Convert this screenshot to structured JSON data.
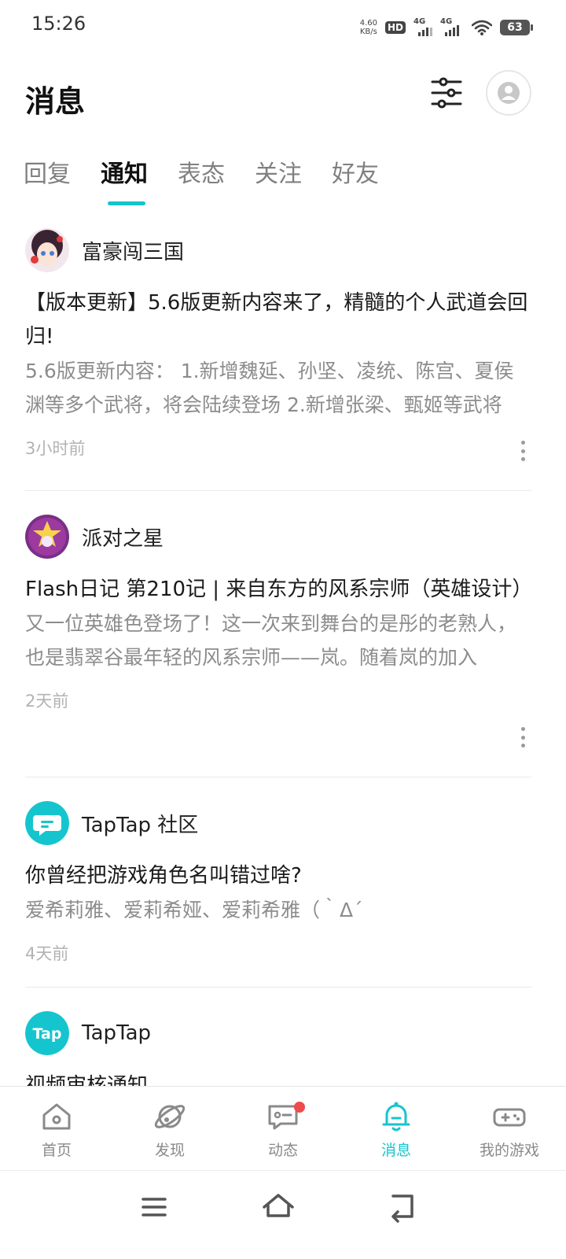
{
  "status_bar": {
    "time": "15:26",
    "net_speed_value": "4.60",
    "net_speed_unit": "KB/s",
    "hd_label": "HD",
    "sim1_label": "4G",
    "sim2_label": "4G",
    "battery": "63"
  },
  "header": {
    "title": "消息"
  },
  "tabs": [
    {
      "label": "回复",
      "active": false
    },
    {
      "label": "通知",
      "active": true
    },
    {
      "label": "表态",
      "active": false
    },
    {
      "label": "关注",
      "active": false
    },
    {
      "label": "好友",
      "active": false
    }
  ],
  "notifications": [
    {
      "sender": "富豪闯三国",
      "title": "【版本更新】5.6版更新内容来了，精髓的个人武道会回归!",
      "body": "5.6版更新内容： 1.新增魏延、孙坚、凌统、陈宫、夏侯渊等多个武将，将会陆续登场 2.新增张梁、甄姬等武将",
      "time": "3小时前"
    },
    {
      "sender": "派对之星",
      "title": "Flash日记 第210记 | 来自东方的风系宗师（英雄设计）",
      "body": "又一位英雄色登场了！这一次来到舞台的是彤的老熟人，也是翡翠谷最年轻的风系宗师——岚。随着岚的加入",
      "time": "2天前"
    },
    {
      "sender": "TapTap 社区",
      "title": "你曾经把游戏角色名叫错过啥?",
      "body": "爱希莉雅、爱莉希娅、爱莉希雅（｀Δ´",
      "time": "4天前"
    },
    {
      "sender": "TapTap",
      "title": "视频审核通知",
      "body": "",
      "time": ""
    }
  ],
  "bottom_nav": [
    {
      "label": "首页",
      "icon": "home-icon"
    },
    {
      "label": "发现",
      "icon": "planet-icon"
    },
    {
      "label": "动态",
      "icon": "chat-bubble-icon"
    },
    {
      "label": "消息",
      "icon": "bell-icon",
      "active": true
    },
    {
      "label": "我的游戏",
      "icon": "gamepad-icon"
    }
  ],
  "colors": {
    "accent": "#15c5ce",
    "badge": "#f04a4a",
    "muted_text": "#8c8c8c"
  }
}
